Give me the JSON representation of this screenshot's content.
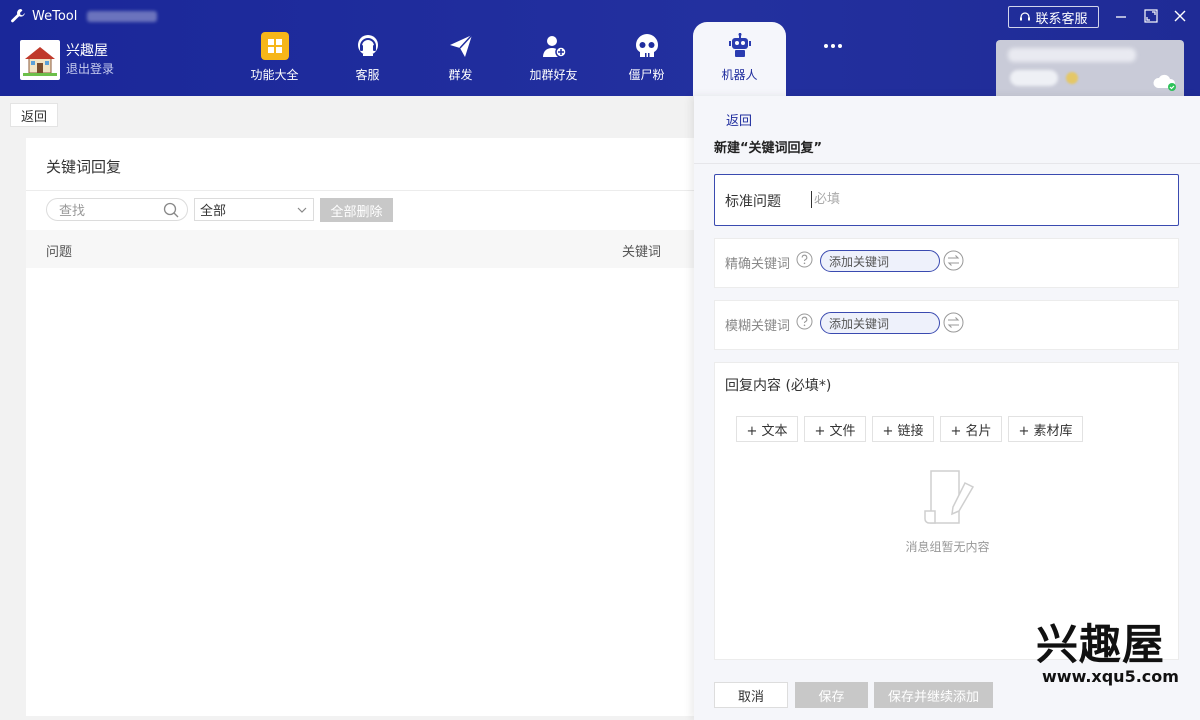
{
  "app": {
    "title": "WeTool",
    "contact_label": "联系客服"
  },
  "user": {
    "name": "兴趣屋",
    "logout": "退出登录"
  },
  "nav": [
    {
      "label": "功能大全",
      "icon": "grid-icon"
    },
    {
      "label": "客服",
      "icon": "headset-icon"
    },
    {
      "label": "群发",
      "icon": "send-icon"
    },
    {
      "label": "加群好友",
      "icon": "add-user-icon"
    },
    {
      "label": "僵尸粉",
      "icon": "skull-icon"
    },
    {
      "label": "机器人",
      "icon": "robot-icon",
      "active": true
    },
    {
      "label": "",
      "icon": "more-icon"
    }
  ],
  "left": {
    "back_label": "返回",
    "panel_title": "关键词回复",
    "search_placeholder": "查找",
    "filter_value": "全部",
    "delete_all_label": "全部删除",
    "columns": [
      "问题",
      "关键词"
    ]
  },
  "drawer": {
    "back_label": "返回",
    "title": "新建“关键词回复”",
    "standard_question_label": "标准问题",
    "standard_question_placeholder": "必填",
    "exact_kw_label": "精确关键词",
    "fuzzy_kw_label": "模糊关键词",
    "add_kw_label": "添加关键词",
    "reply_label": "回复内容 (必填*)",
    "add_buttons": [
      "+ 文本",
      "+ 文件",
      "+ 链接",
      "+ 名片",
      "+ 素材库"
    ],
    "empty_text": "消息组暂无内容",
    "cancel_label": "取消",
    "save_label": "保存",
    "save_next_label": "保存并继续添加"
  },
  "watermark": {
    "brand": "兴趣屋",
    "url": "www.xqu5.com"
  },
  "colors": {
    "header": "#1f2d9e",
    "accent": "#3a4ab0",
    "disabled": "#c8c8c8"
  }
}
